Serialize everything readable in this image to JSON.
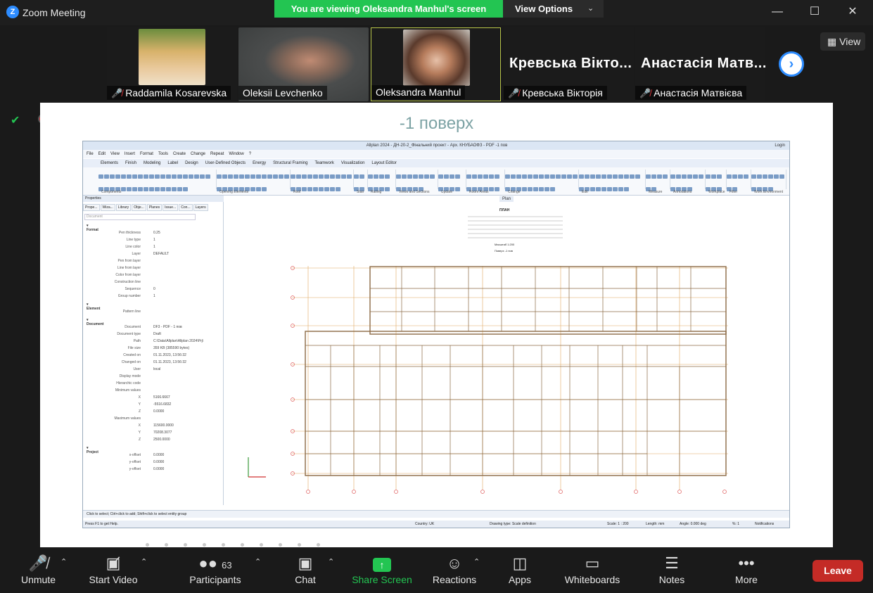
{
  "window": {
    "title": "Zoom Meeting",
    "logo": "Z"
  },
  "banner": {
    "text": "You are viewing Oleksandra Manhul's screen",
    "view_options": "View Options"
  },
  "participants": [
    {
      "name": "Raddamila Kosarevska",
      "muted": true,
      "video": true
    },
    {
      "name": "Oleksii Levchenko",
      "muted": false,
      "video": true
    },
    {
      "name": "Oleksandra Manhul",
      "muted": false,
      "video": true,
      "active": true
    },
    {
      "name": "Кревська Вікторія",
      "display": "Кревська Вікто...",
      "muted": true,
      "video": false
    },
    {
      "name": "Анастасія Матвієва",
      "display": "Анастасія Матв...",
      "muted": true,
      "video": false
    }
  ],
  "view_button": "View",
  "slide": {
    "title": "-1 поверх"
  },
  "allplan": {
    "title": "Allplan 2024 - ДН-20-2_Фінальний проект - Арх. КНУБАОФЗ - PDF -1 пов",
    "login": "Login",
    "menu": [
      "File",
      "Edit",
      "View",
      "Insert",
      "Format",
      "Tools",
      "Create",
      "Change",
      "Repeat",
      "Window",
      "?"
    ],
    "tabs": [
      "Elements",
      "Finish",
      "Modeling",
      "Label",
      "Design",
      "User-Defined Objects",
      "Energy",
      "Structural Framing",
      "Teamwork",
      "Visualization",
      "Layout Editor"
    ],
    "ribbon_groups": [
      "Components",
      "Opening Elements",
      "Roof",
      "Stair",
      "Railing",
      "Views and Sections",
      "Update",
      "Room Areas",
      "Change",
      "Edit",
      "Measure",
      "Annotations",
      "Workplace",
      "Filter",
      "Work Environment"
    ],
    "properties_header": "Properties",
    "properties_tabs": [
      "Prope...",
      "Wiza...",
      "Library",
      "Obje...",
      "Planes",
      "Issue...",
      "Con...",
      "Layers"
    ],
    "document_field": "Document",
    "sections": {
      "format": "Format",
      "element": "Element",
      "document": "Document",
      "project": "Project"
    },
    "format_rows": [
      {
        "k": "Pen thickness",
        "v": "0.25"
      },
      {
        "k": "Line type",
        "v": "1"
      },
      {
        "k": "Line color",
        "v": "1"
      },
      {
        "k": "Layer",
        "v": "DEFAULT"
      },
      {
        "k": "Pen from layer",
        "v": ""
      },
      {
        "k": "Line from layer",
        "v": ""
      },
      {
        "k": "Color from layer",
        "v": ""
      },
      {
        "k": "Construction line",
        "v": ""
      },
      {
        "k": "Sequence",
        "v": "0"
      },
      {
        "k": "Group number",
        "v": "1"
      }
    ],
    "element_rows": [
      {
        "k": "Pattern line",
        "v": ""
      }
    ],
    "document_rows": [
      {
        "k": "Document",
        "v": "DF3 - PDF - 1 пов"
      },
      {
        "k": "Document type",
        "v": "Draft"
      },
      {
        "k": "Path",
        "v": "C:\\Data\\Allplan\\Allplan 2024\\Prj\\"
      },
      {
        "k": "File size",
        "v": "359 KB (385590 bytes)"
      },
      {
        "k": "Created on",
        "v": "01.11.2023, 13:56:32"
      },
      {
        "k": "Changed on",
        "v": "01.11.2023, 13:56:32"
      },
      {
        "k": "User",
        "v": "local"
      },
      {
        "k": "Display mode",
        "v": ""
      },
      {
        "k": "Hierarchic code",
        "v": ""
      },
      {
        "k": "Minimum values",
        "v": ""
      },
      {
        "k": "X",
        "v": "5166.6667"
      },
      {
        "k": "Y",
        "v": "-5516.6832"
      },
      {
        "k": "Z",
        "v": "0.0000"
      },
      {
        "k": "Maximum values",
        "v": ""
      },
      {
        "k": "X",
        "v": "115600.0000"
      },
      {
        "k": "Y",
        "v": "70208.3077"
      },
      {
        "k": "Z",
        "v": "2500.0000"
      }
    ],
    "project_rows": [
      {
        "k": "x-offset",
        "v": "0.0000"
      },
      {
        "k": "y-offset",
        "v": "0.0000"
      },
      {
        "k": "y-offset",
        "v": "0.0000"
      }
    ],
    "view_label": "Plan",
    "drawing_header": "ПЛАН",
    "drawing_scale": "Масштаб 1:200",
    "drawing_floor": "Поверх -1 пов",
    "status_hint": "Click to select; Ctrl+click to add; Shift+click to select entity group",
    "status_help": "Press F1 to get Help.",
    "status_country": "Country:  UK",
    "status_drawing_type": "Drawing type:  Scale definition",
    "status_scale": "Scale:  1 : 200",
    "status_length": "Length:  mm",
    "status_angle": "Angle:  0.000   deg",
    "status_percent": "%:  1",
    "status_notifications": "Notifications"
  },
  "toolbar": {
    "unmute": "Unmute",
    "start_video": "Start Video",
    "participants": "Participants",
    "participants_count": "63",
    "chat": "Chat",
    "share_screen": "Share Screen",
    "reactions": "Reactions",
    "apps": "Apps",
    "whiteboards": "Whiteboards",
    "notes": "Notes",
    "more": "More",
    "leave": "Leave"
  },
  "colors": {
    "share_green": "#23c552",
    "leave_red": "#c42b26",
    "accent_blue": "#2d8cff"
  }
}
